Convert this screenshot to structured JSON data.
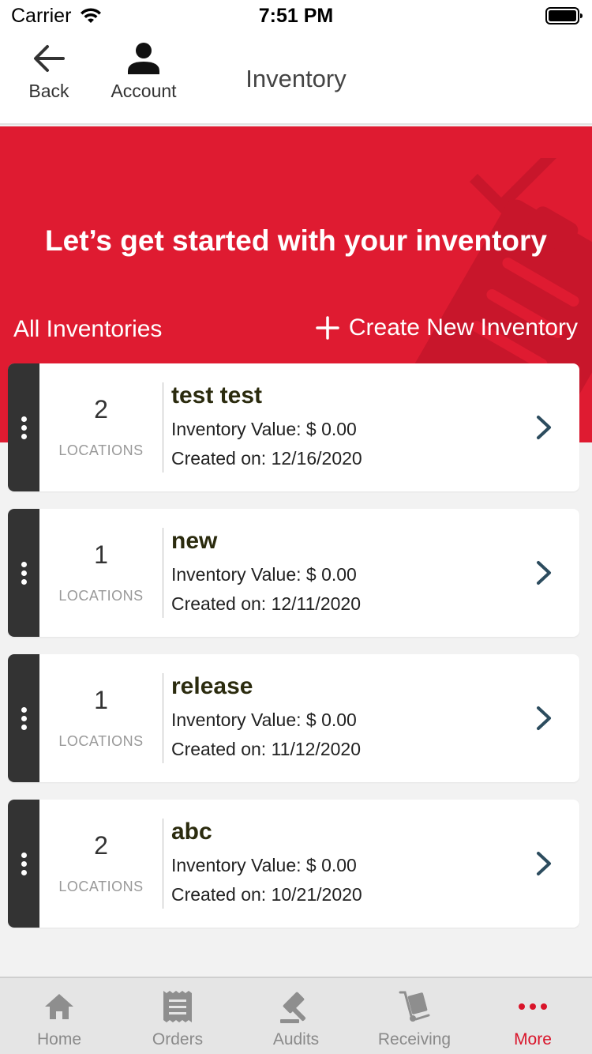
{
  "status_bar": {
    "carrier": "Carrier",
    "time": "7:51 PM"
  },
  "nav": {
    "back_label": "Back",
    "account_label": "Account",
    "title": "Inventory"
  },
  "hero": {
    "title": "Let’s get started with your inventory",
    "section_label": "All Inventories",
    "create_label": "Create New Inventory",
    "accent_color": "#df1b31"
  },
  "inventories": [
    {
      "count": "2",
      "count_label": "LOCATIONS",
      "name": "test test",
      "value": "Inventory Value: $ 0.00",
      "created": "Created on: 12/16/2020"
    },
    {
      "count": "1",
      "count_label": "LOCATIONS",
      "name": "new",
      "value": "Inventory Value: $ 0.00",
      "created": "Created on: 12/11/2020"
    },
    {
      "count": "1",
      "count_label": "LOCATIONS",
      "name": "release",
      "value": "Inventory Value: $ 0.00",
      "created": "Created on: 11/12/2020"
    },
    {
      "count": "2",
      "count_label": "LOCATIONS",
      "name": "abc",
      "value": "Inventory Value: $ 0.00",
      "created": "Created on: 10/21/2020"
    }
  ],
  "tabs": [
    {
      "label": "Home",
      "icon": "home-icon"
    },
    {
      "label": "Orders",
      "icon": "receipt-icon"
    },
    {
      "label": "Audits",
      "icon": "gavel-icon"
    },
    {
      "label": "Receiving",
      "icon": "hand-truck-icon"
    },
    {
      "label": "More",
      "icon": "more-dots-icon",
      "active": true
    }
  ]
}
